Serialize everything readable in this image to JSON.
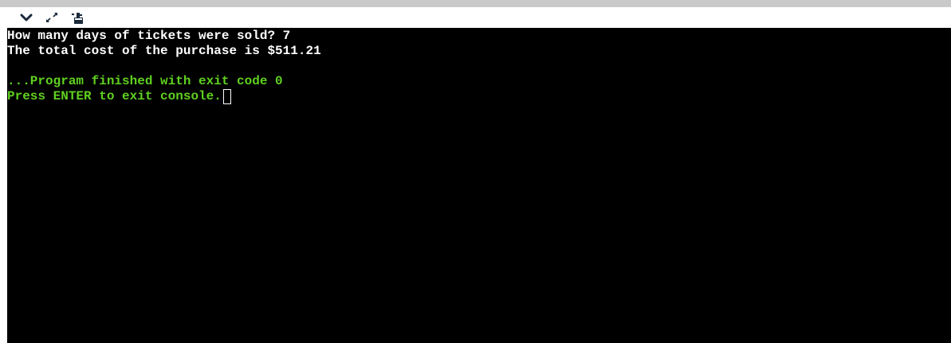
{
  "toolbar": {
    "buttons": [
      {
        "icon": "chevron-down-icon"
      },
      {
        "icon": "expand-icon"
      },
      {
        "icon": "clear-console-icon"
      }
    ]
  },
  "console": {
    "lines": [
      {
        "text": "How many days of tickets were sold? 7",
        "color": "#ffffff"
      },
      {
        "text": "The total cost of the purchase is $511.21",
        "color": "#ffffff"
      },
      {
        "text": "",
        "color": "#ffffff"
      },
      {
        "text": "...Program finished with exit code 0",
        "color": "#5fd021"
      },
      {
        "text": "Press ENTER to exit console.",
        "color": "#5fd021"
      }
    ]
  }
}
